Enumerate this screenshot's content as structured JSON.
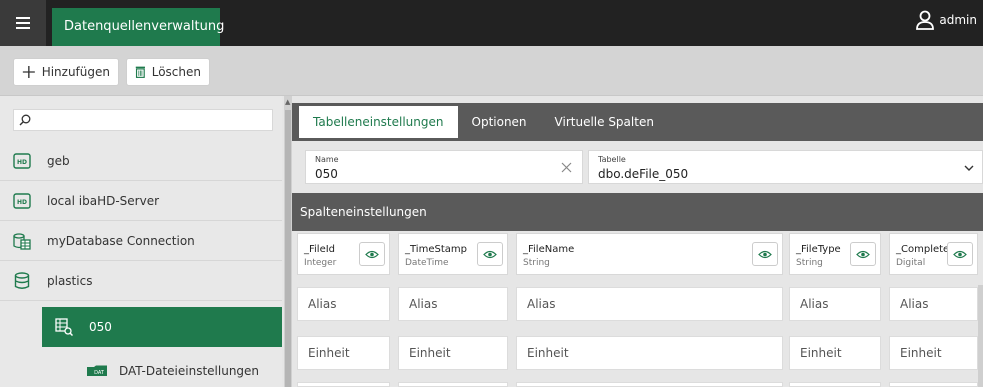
{
  "header": {
    "title": "Datenquellenverwaltung",
    "user": "admin"
  },
  "toolbar": {
    "add_label": "Hinzufügen",
    "delete_label": "Löschen"
  },
  "sidebar": {
    "search_placeholder": "",
    "items": [
      {
        "label": "geb",
        "icon": "hd-server-icon"
      },
      {
        "label": "local ibaHD-Server",
        "icon": "hd-server-icon"
      },
      {
        "label": "myDatabase Connection",
        "icon": "database-table-icon"
      },
      {
        "label": "plastics",
        "icon": "database-icon"
      },
      {
        "label": "050",
        "icon": "table-search-icon"
      },
      {
        "label": "DAT-Dateieinstellungen",
        "icon": "dat-folder-icon"
      }
    ]
  },
  "tabs": [
    {
      "label": "Tabelleneinstellungen"
    },
    {
      "label": "Optionen"
    },
    {
      "label": "Virtuelle Spalten"
    }
  ],
  "name_field": {
    "label": "Name",
    "value": "050"
  },
  "table_field": {
    "label": "Tabelle",
    "value": "dbo.deFile_050"
  },
  "section": {
    "title": "Spalteneinstellungen"
  },
  "columns": [
    {
      "name": "_FileId",
      "type": "Integer"
    },
    {
      "name": "_TimeStamp",
      "type": "DateTime"
    },
    {
      "name": "_FileName",
      "type": "String"
    },
    {
      "name": "_FileType",
      "type": "String"
    },
    {
      "name": "_Complete",
      "type": "Digital"
    }
  ],
  "rows": {
    "alias_placeholder": "Alias",
    "unit_placeholder": "Einheit"
  },
  "colors": {
    "accent": "#1f7a4d",
    "topbar": "#222222",
    "panel_header": "#5a5a5a"
  }
}
